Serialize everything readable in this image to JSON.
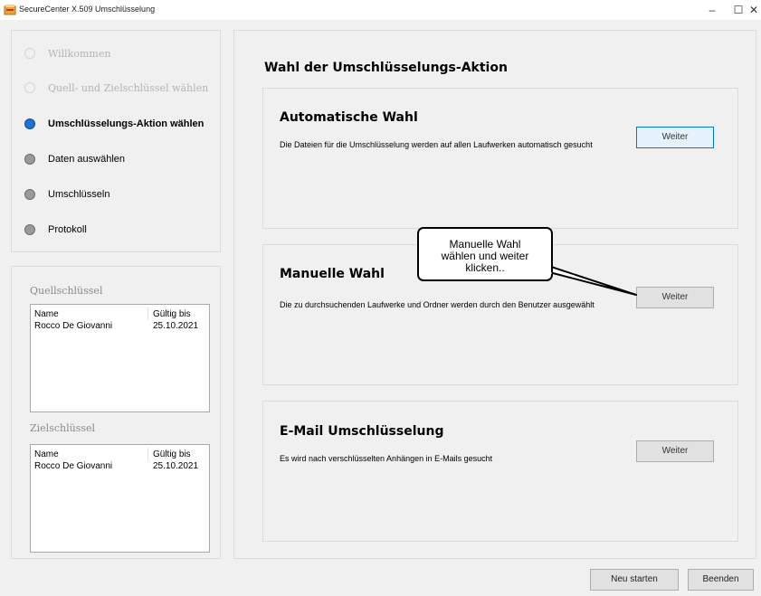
{
  "window": {
    "title": "SecureCenter X.509 Umschlüsselung",
    "min": "–",
    "max": "☐",
    "close": "✕"
  },
  "steps": [
    {
      "label": "Willkommen",
      "state": "disabled"
    },
    {
      "label": "Quell- und Zielschlüssel wählen",
      "state": "disabled"
    },
    {
      "label": "Umschlüsselungs-Aktion wählen",
      "state": "active"
    },
    {
      "label": "Daten auswählen",
      "state": "pending"
    },
    {
      "label": "Umschlüsseln",
      "state": "pending"
    },
    {
      "label": "Protokoll",
      "state": "pending"
    }
  ],
  "source_keys": {
    "heading": "Quellschlüssel",
    "columns": [
      "Name",
      "Gültig bis"
    ],
    "rows": [
      [
        "Rocco De Giovanni",
        "25.10.2021"
      ]
    ]
  },
  "target_keys": {
    "heading": "Zielschlüssel",
    "columns": [
      "Name",
      "Gültig bis"
    ],
    "rows": [
      [
        "Rocco De Giovanni",
        "25.10.2021"
      ]
    ]
  },
  "main": {
    "title": "Wahl der Umschlüsselungs-Aktion",
    "options": [
      {
        "title": "Automatische Wahl",
        "description": "Die Dateien für die Umschlüsselung werden auf allen Laufwerken automatisch gesucht",
        "button": "Weiter"
      },
      {
        "title": "Manuelle Wahl",
        "description": "Die zu durchsuchenden Laufwerke und Ordner werden durch den Benutzer ausgewählt",
        "button": "Weiter"
      },
      {
        "title": "E-Mail Umschlüsselung",
        "description": "Es wird nach verschlüsselten Anhängen in E-Mails gesucht",
        "button": "Weiter"
      }
    ]
  },
  "callout": {
    "text": "Manuelle Wahl\nwählen und weiter\nklicken.."
  },
  "footer": {
    "restart": "Neu starten",
    "quit": "Beenden"
  },
  "colors": {
    "active_step": "#1e73d2",
    "pending_step": "#9a9a9a",
    "focus_border": "#0078d7"
  },
  "icons": {
    "app": "certificate-folder-icon"
  }
}
